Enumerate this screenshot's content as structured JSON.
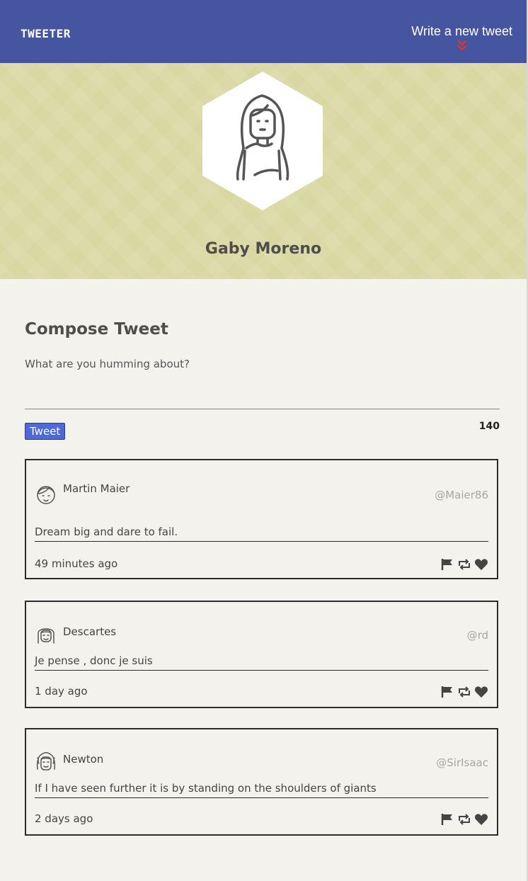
{
  "nav": {
    "brand": "TWEETER",
    "compose_toggle": "Write a new tweet",
    "chevron_color": "#e0342c",
    "background": "#4655a0"
  },
  "profile": {
    "name": "Gaby Moreno",
    "avatar_icon": "woman-avatar-icon"
  },
  "compose": {
    "title": "Compose Tweet",
    "placeholder": "What are you humming about?",
    "value": "",
    "button_label": "Tweet",
    "counter": "140"
  },
  "tweets": [
    {
      "name": "Martin Maier",
      "handle": "@Maier86",
      "text": "Dream big and dare to fail.",
      "time": "49 minutes ago",
      "avatar_icon": "man-avatar-icon"
    },
    {
      "name": "Descartes",
      "handle": "@rd",
      "text": "Je pense , donc je suis",
      "time": "1 day ago",
      "avatar_icon": "descartes-avatar-icon"
    },
    {
      "name": "Newton",
      "handle": "@SirIsaac",
      "text": "If I have seen further it is by standing on the shoulders of giants",
      "time": "2 days ago",
      "avatar_icon": "newton-avatar-icon"
    }
  ],
  "tweet_actions": [
    "flag-icon",
    "retweet-icon",
    "heart-icon"
  ]
}
